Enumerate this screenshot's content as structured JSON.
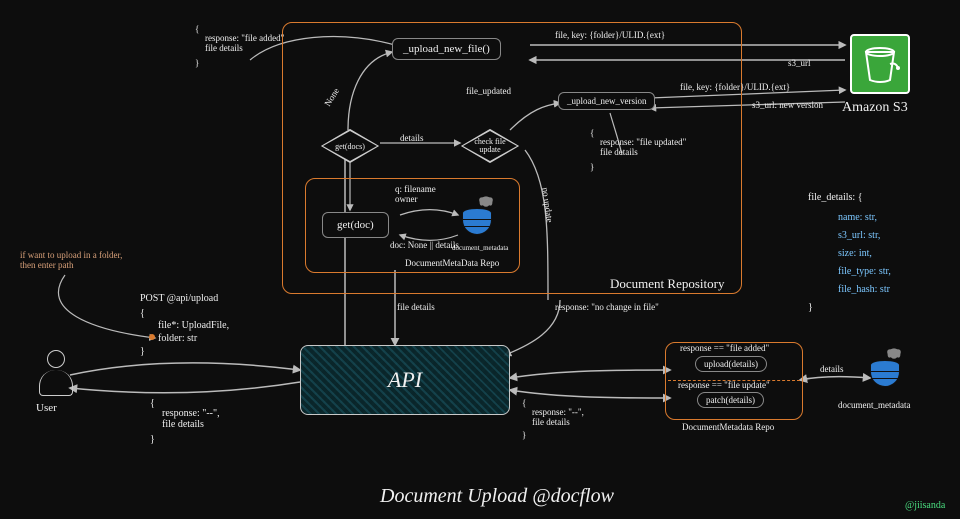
{
  "title": "Document Upload @docflow",
  "credit": "@jiisanda",
  "user": {
    "label": "User"
  },
  "amazon_s3": {
    "label": "Amazon S3"
  },
  "api": {
    "label": "API"
  },
  "doc_repo": {
    "label": "Document Repository"
  },
  "meta_repo_inner": {
    "label": "DocumentMetaData Repo"
  },
  "meta_repo_right": {
    "label": "DocumentMetadata Repo"
  },
  "document_metadata": {
    "label": "document_metadata"
  },
  "document_metadata_small": {
    "label": "document_metadata"
  },
  "upload_new_file": {
    "label": "_upload_new_file()"
  },
  "upload_new_version": {
    "label": "_upload_new_version"
  },
  "get_doc": {
    "label": "get(doc)"
  },
  "get_docs_diamond": {
    "label": "get(docs)"
  },
  "check_file_diamond": {
    "label": "check file update"
  },
  "upload_details": {
    "label": "upload(details)"
  },
  "patch_details": {
    "label": "patch(details)"
  },
  "labels": {
    "post": "POST @api/upload",
    "file_field": "file*: UploadFile,",
    "folder_field": "folder: str",
    "note_folder": "if want to upload in a folder,\nthen enter path",
    "resp_dash1": "response: \"--\",\nfile details",
    "resp_dash2": "response: \"--\",\nfile details",
    "resp_added": "response: \"file added\"\nfile details",
    "resp_updated": "response: \"file updated\"\nfile details",
    "resp_no_change": "response: \"no change in file\"",
    "file_key1": "file, key: {folder}/ULID.{ext}",
    "file_key2": "file, key: {folder}/ULID.{ext}",
    "s3_url": "s3_url",
    "s3_url_new": "s3_url: new version",
    "none": "None",
    "details_edge": "details",
    "file_updated": "file_updated",
    "no_update": "no update",
    "q_filename_owner": "q: filename\n   owner",
    "doc_none_details": "doc: None || details",
    "file_details_edge": "file details",
    "resp_eq_added": "response == \"file added\"",
    "resp_eq_update": "response == \"file update\"",
    "details_right": "details"
  },
  "file_details_struct": {
    "header": "file_details: {",
    "name": "name: str,",
    "s3_url": "s3_url: str,",
    "size": "size: int,",
    "file_type": "file_type: str,",
    "file_hash": "file_hash: str",
    "close": "}"
  }
}
